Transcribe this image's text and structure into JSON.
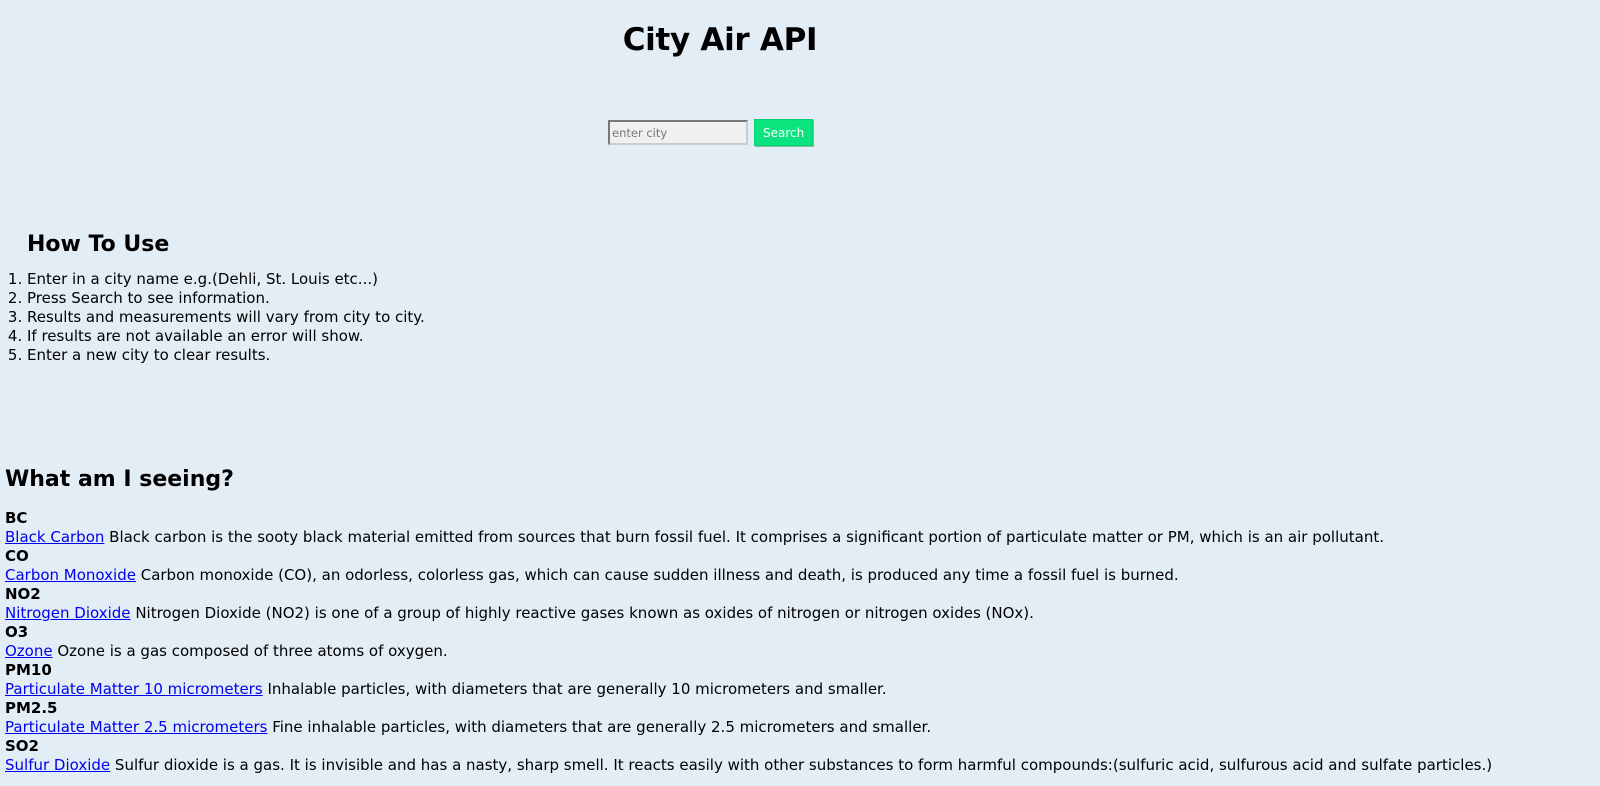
{
  "header": {
    "title": "City Air API"
  },
  "search": {
    "placeholder": "enter city",
    "value": "",
    "button_label": "Search"
  },
  "how_to_use": {
    "title": "How To Use",
    "steps": [
      "Enter in a city name e.g.(Dehli, St. Louis etc...)",
      "Press Search to see information.",
      "Results and measurements will vary from city to city.",
      "If results are not available an error will show.",
      "Enter a new city to clear results."
    ]
  },
  "what_am_i_seeing": {
    "title": "What am I seeing?",
    "pollutants": [
      {
        "code": "BC",
        "link": "Black Carbon",
        "description": " Black carbon is the sooty black material emitted from sources that burn fossil fuel. It comprises a significant portion of particulate matter or PM, which is an air pollutant."
      },
      {
        "code": "CO",
        "link": "Carbon Monoxide",
        "description": " Carbon monoxide (CO), an odorless, colorless gas, which can cause sudden illness and death, is produced any time a fossil fuel is burned."
      },
      {
        "code": "NO2",
        "link": "Nitrogen Dioxide",
        "description": " Nitrogen Dioxide (NO2) is one of a group of highly reactive gases known as oxides of nitrogen or nitrogen oxides (NOx)."
      },
      {
        "code": "O3",
        "link": "Ozone",
        "description": " Ozone is a gas composed of three atoms of oxygen."
      },
      {
        "code": "PM10",
        "link": "Particulate Matter 10 micrometers",
        "description": "  Inhalable particles, with diameters that are generally 10 micrometers and smaller."
      },
      {
        "code": "PM2.5",
        "link": "Particulate Matter 2.5 micrometers",
        "description": "  Fine inhalable particles, with diameters that are generally 2.5 micrometers and smaller."
      },
      {
        "code": "SO2",
        "link": "Sulfur Dioxide",
        "description": " Sulfur dioxide is a gas. It is invisible and has a nasty, sharp smell. It reacts easily with other substances to form harmful compounds:(sulfuric acid, sulfurous acid and sulfate particles.)"
      }
    ]
  },
  "colors": {
    "background": "#e2edf6",
    "search_button": "#0be37f",
    "link": "#0000ee"
  }
}
